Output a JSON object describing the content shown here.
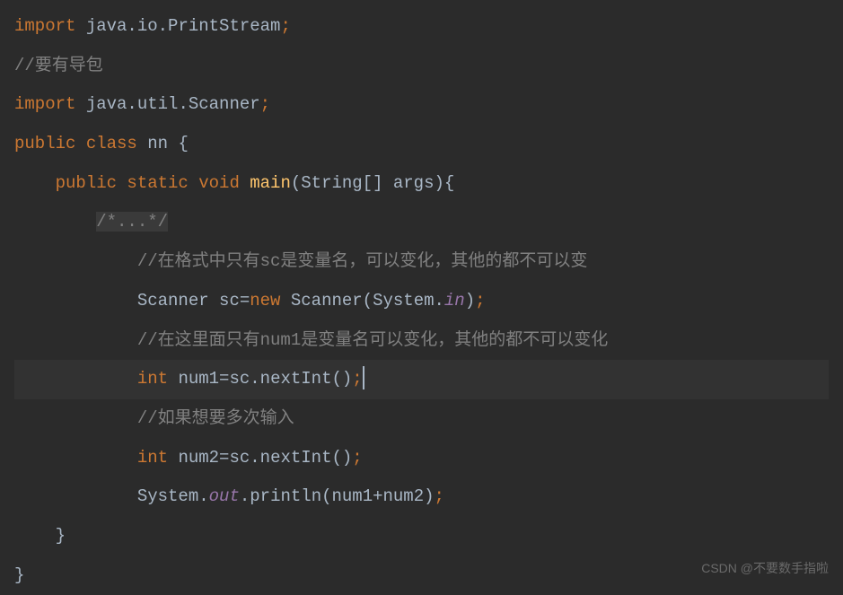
{
  "code": {
    "line1": {
      "keyword": "import",
      "pkg": " java.io.PrintStream",
      "semi": ";"
    },
    "line2": {
      "comment": "//要有导包"
    },
    "line3": {
      "keyword": "import",
      "pkg": " java.util.Scanner",
      "semi": ";"
    },
    "line4": {
      "kw1": "public class ",
      "name": "nn ",
      "brace": "{"
    },
    "line5": {
      "indent": "    ",
      "kw": "public static void ",
      "method": "main",
      "params": "(String[] args){"
    },
    "line6": {
      "indent": "        ",
      "comment": "/*...*/"
    },
    "line7": {
      "indent": "            ",
      "comment": "//在格式中只有sc是变量名，可以变化，其他的都不可以变"
    },
    "line8": {
      "indent": "            ",
      "text1": "Scanner sc=",
      "kw": "new",
      "text2": " Scanner(System.",
      "field": "in",
      "text3": ")",
      "semi": ";"
    },
    "line9": {
      "indent": "            ",
      "comment": "//在这里面只有num1是变量名可以变化，其他的都不可以变化"
    },
    "line10": {
      "indent": "            ",
      "kw": "int",
      "text": " num1=sc.nextInt()",
      "semi": ";"
    },
    "line11": {
      "indent": "            ",
      "comment": "//如果想要多次输入"
    },
    "line12": {
      "indent": "            ",
      "kw": "int",
      "text": " num2=sc.nextInt()",
      "semi": ";"
    },
    "line13": {
      "indent": "            ",
      "text1": "System.",
      "field": "out",
      "text2": ".println(num1+num2)",
      "semi": ";"
    },
    "line14": {
      "indent": "    ",
      "brace": "}"
    },
    "line15": {
      "brace": "}"
    }
  },
  "watermark": "CSDN @不要数手指啦"
}
